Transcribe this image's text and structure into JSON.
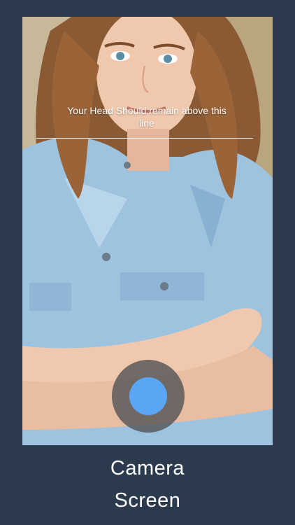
{
  "camera": {
    "guide_text": "Your Head Should remain above this line"
  },
  "caption": {
    "line1": "Camera",
    "line2": "Screen"
  },
  "colors": {
    "background": "#2c3a4e",
    "shutter_outer": "#555558",
    "shutter_inner": "#5aa6f5"
  }
}
